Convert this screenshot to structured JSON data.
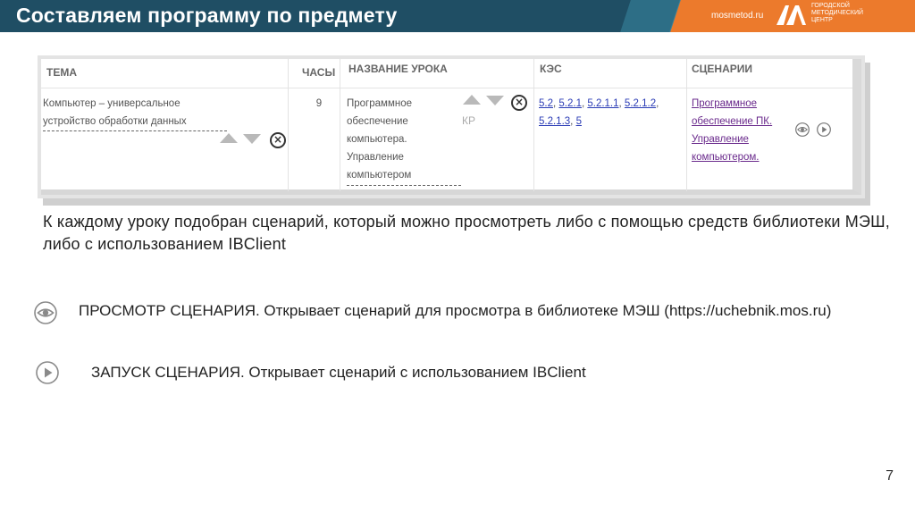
{
  "header": {
    "title": "Составляем программу по предмету",
    "site": "mosmetod.ru",
    "logo_lines": [
      "ГОРОДСКОЙ",
      "МЕТОДИЧЕСКИЙ",
      "ЦЕНТР"
    ],
    "colors": {
      "bar": "#1f4e64",
      "accent": "#ec7a2c"
    }
  },
  "table": {
    "headers": [
      "ТЕМА",
      "ЧАСЫ",
      "НАЗВАНИЕ УРОКА",
      "КЭС",
      "СЦЕНАРИИ"
    ],
    "topic_lines": [
      "Компьютер – универсальное",
      "устройство обработки данных"
    ],
    "hours": "9",
    "lesson_lines": [
      "Программное",
      "обеспечение",
      "компьютера.",
      "Управление",
      "компьютером"
    ],
    "kr_label": "КР",
    "kes_row1": [
      "5.2",
      "5.2.1",
      "5.2.1.1",
      "5.2.1.2"
    ],
    "kes_row2": [
      "5.2.1.3",
      "5"
    ],
    "scenario_lines": [
      "Программное",
      "обеспечение ПК.",
      "Управление",
      "компьютером."
    ],
    "remove_symbol": "×"
  },
  "paragraph": "К каждому уроку подобран сценарий, который можно просмотреть либо с помощью средств библиотеки МЭШ, либо с использованием IBClient",
  "items": [
    {
      "icon": "eye-icon",
      "text": "ПРОСМОТР СЦЕНАРИЯ. Открывает сценарий для просмотра в библиотеке МЭШ (https://uchebnik.mos.ru)"
    },
    {
      "icon": "play-icon",
      "text": "ЗАПУСК СЦЕНАРИЯ. Открывает сценарий с использованием IBClient"
    }
  ],
  "page_number": "7"
}
